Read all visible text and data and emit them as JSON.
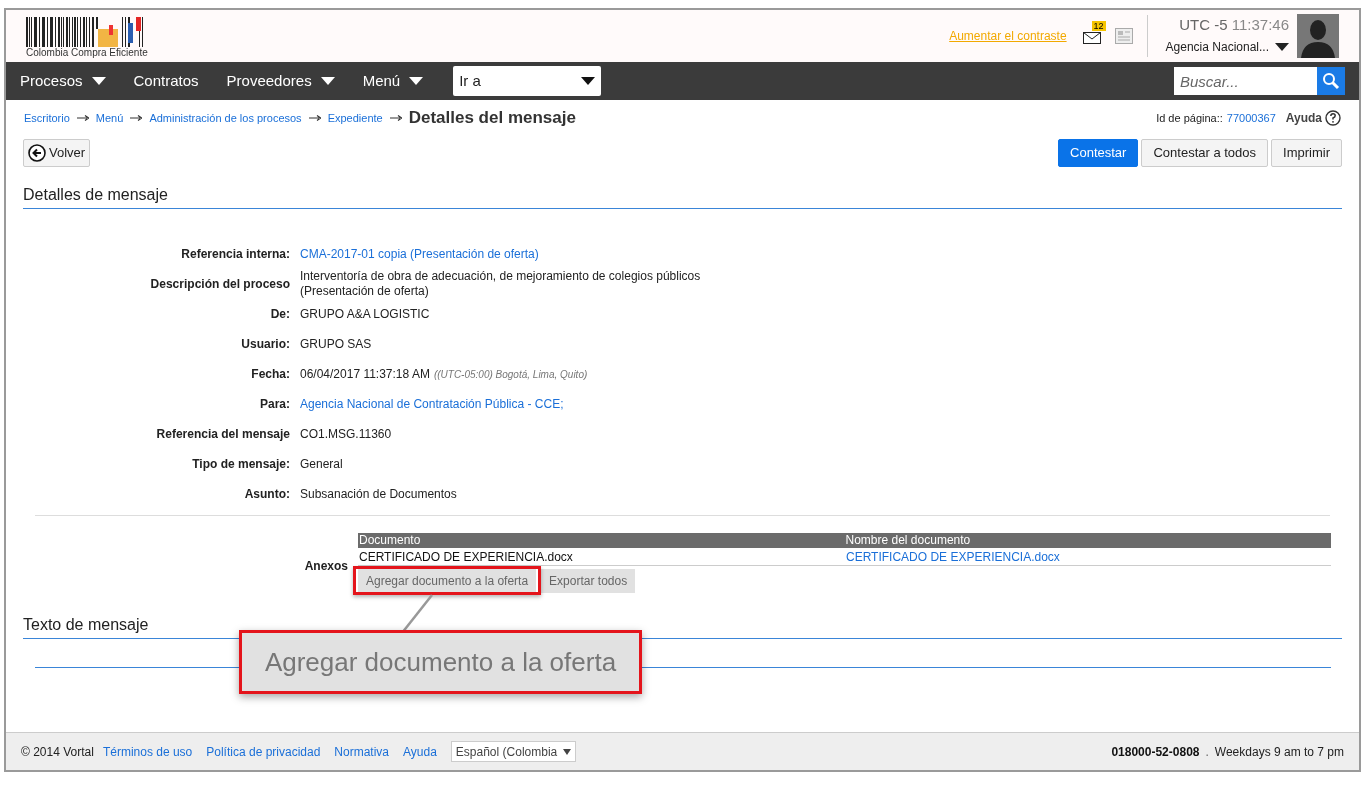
{
  "header": {
    "logo_text": "Colombia Compra Eficiente",
    "contrast_link": "Aumentar el contraste",
    "mail_badge": "12",
    "timezone": "UTC -5",
    "time": "11:37:46",
    "agency": "Agencia Nacional..."
  },
  "nav": {
    "items": [
      {
        "label": "Procesos",
        "kind": "dropdown"
      },
      {
        "label": "Contratos",
        "kind": "link"
      },
      {
        "label": "Proveedores",
        "kind": "dropdown"
      },
      {
        "label": "Menú",
        "kind": "dropdown"
      }
    ],
    "goto": "Ir a",
    "search_placeholder": "Buscar..."
  },
  "breadcrumb": {
    "items": [
      "Escritorio",
      "Menú",
      "Administración de los procesos",
      "Expediente"
    ],
    "current": "Detalles del mensaje"
  },
  "page_id": {
    "label": "Id de página::",
    "value": "77000367",
    "help": "Ayuda"
  },
  "back_button": "Volver",
  "actions": [
    {
      "label": "Contestar",
      "kind": "primary"
    },
    {
      "label": "Contestar a todos",
      "kind": "default"
    },
    {
      "label": "Imprimir",
      "kind": "default"
    }
  ],
  "details_title": "Detalles de mensaje",
  "fields": [
    {
      "label": "Referencia interna:",
      "value": "CMA-2017-01 copia (Presentación de oferta)",
      "kind": "link"
    },
    {
      "label": "Descripción del proceso",
      "value": "Interventoría de obra de adecuación, de mejoramiento de colegios públicos\n(Presentación de oferta)",
      "kind": "text"
    },
    {
      "label": "De:",
      "value": "GRUPO A&A LOGISTIC",
      "kind": "text"
    },
    {
      "label": "Usuario:",
      "value": "GRUPO SAS",
      "kind": "text"
    },
    {
      "label": "Fecha:",
      "value": "06/04/2017 11:37:18 AM",
      "note": "((UTC-05:00) Bogotá, Lima, Quito)",
      "kind": "text"
    },
    {
      "label": "Para:",
      "value": "Agencia Nacional de Contratación Pública - CCE;",
      "kind": "link"
    },
    {
      "label": "Referencia del mensaje",
      "value": "CO1.MSG.11360",
      "kind": "text"
    },
    {
      "label": "Tipo de mensaje:",
      "value": "General",
      "kind": "text"
    },
    {
      "label": "Asunto:",
      "value": "Subsanación de Documentos",
      "kind": "text"
    }
  ],
  "attachments": {
    "label": "Anexos",
    "columns": [
      "Documento",
      "Nombre del documento"
    ],
    "rows": [
      [
        "CERTIFICADO DE EXPERIENCIA.docx",
        "CERTIFICADO DE EXPERIENCIA.docx"
      ]
    ],
    "buttons": [
      "Agregar documento a la oferta",
      "Exportar todos"
    ]
  },
  "message_title": "Texto de mensaje",
  "callout": "Agregar documento a la oferta",
  "footer": {
    "copyright": "© 2014 Vortal",
    "links": [
      "Términos de uso",
      "Política de privacidad",
      "Normativa",
      "Ayuda"
    ],
    "language": "Español (Colombia",
    "phone": "018000-52-0808",
    "separator": ".",
    "hours": "Weekdays 9 am to 7 pm"
  }
}
